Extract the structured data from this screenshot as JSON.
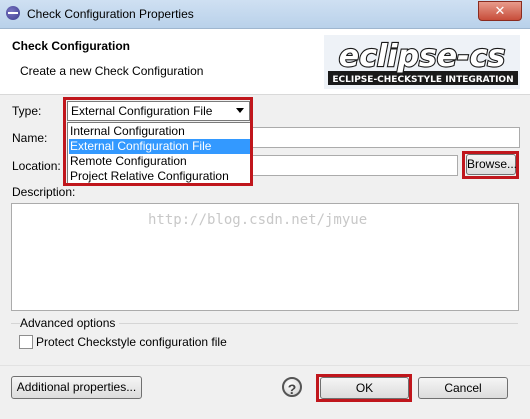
{
  "window": {
    "title": "Check Configuration Properties",
    "close_label": "✕"
  },
  "header": {
    "title": "Check Configuration",
    "subtitle": "Create a new Check Configuration",
    "logo_main": "eclipse-cs",
    "logo_sub": "ECLIPSE-CHECKSTYLE INTEGRATION"
  },
  "form": {
    "type_label": "Type:",
    "type_value": "External Configuration File",
    "type_options": [
      "Internal Configuration",
      "External Configuration File",
      "Remote Configuration",
      "Project Relative Configuration"
    ],
    "name_label": "Name:",
    "location_label": "Location:",
    "browse_label": "Browse...",
    "description_label": "Description:"
  },
  "watermark": "http://blog.csdn.net/jmyue",
  "advanced": {
    "legend": "Advanced options",
    "protect_label": "Protect Checkstyle configuration file"
  },
  "footer": {
    "additional_label": "Additional properties...",
    "ok_label": "OK",
    "cancel_label": "Cancel",
    "help_glyph": "?"
  },
  "colors": {
    "highlight": "#3399ff",
    "annotation_red": "#c0161c"
  }
}
